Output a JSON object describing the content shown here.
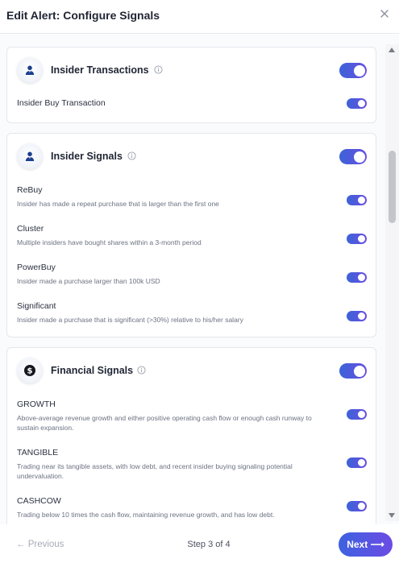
{
  "header": {
    "title": "Edit Alert: Configure Signals",
    "close_icon": "close-icon"
  },
  "cards": [
    {
      "title": "Insider Transactions",
      "icon": "user-icon",
      "enabled": true,
      "items": [
        {
          "label": "Insider Buy Transaction",
          "enabled": true
        }
      ]
    },
    {
      "title": "Insider Signals",
      "icon": "user-icon",
      "enabled": true,
      "items": [
        {
          "label": "ReBuy",
          "desc": "Insider has made a repeat purchase that is larger than the first one",
          "enabled": true
        },
        {
          "label": "Cluster",
          "desc": "Multiple insiders have bought shares within a 3-month period",
          "enabled": true
        },
        {
          "label": "PowerBuy",
          "desc": "Insider made a purchase larger than 100k USD",
          "enabled": true
        },
        {
          "label": "Significant",
          "desc": "Insider made a purchase that is significant (>30%) relative to his/her salary",
          "enabled": true
        }
      ]
    },
    {
      "title": "Financial Signals",
      "icon": "dollar-icon",
      "enabled": true,
      "items": [
        {
          "label": "GROWTH",
          "desc": "Above-average revenue growth and either positive operating cash flow or enough cash runway to sustain expansion.",
          "enabled": true
        },
        {
          "label": "TANGIBLE",
          "desc": "Trading near its tangible assets, with low debt, and recent insider buying signaling potential undervaluation.",
          "enabled": true
        },
        {
          "label": "CASHCOW",
          "desc": "Trading below 10 times the cash flow, maintaining revenue growth, and has low debt.",
          "enabled": true
        }
      ]
    }
  ],
  "footer": {
    "prev_label": "← Previous",
    "step_label": "Step 3 of 4",
    "next_label": "Next ⟶"
  },
  "colors": {
    "accent": "#4f5be0",
    "toggle_start": "#3b63d8",
    "toggle_end": "#6a4fe0"
  }
}
